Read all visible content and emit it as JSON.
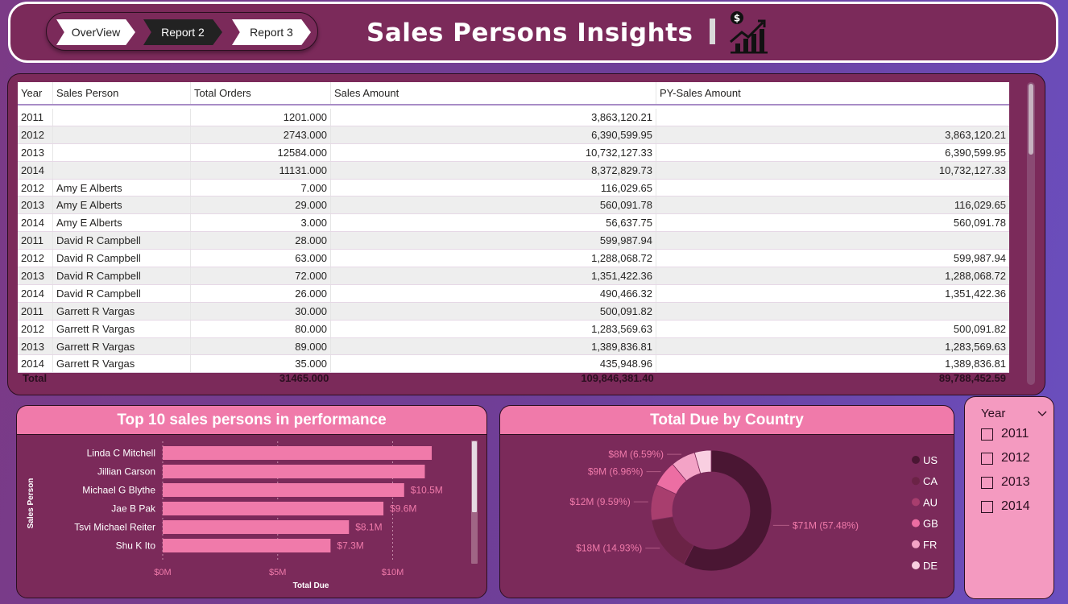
{
  "nav": {
    "buttons": [
      "OverView",
      "Report 2",
      "Report 3"
    ]
  },
  "header": {
    "title": "Sales Persons Insights"
  },
  "table": {
    "columns": [
      "Year",
      "Sales Person",
      "Total Orders",
      "Sales Amount",
      "PY-Sales Amount"
    ],
    "rows": [
      [
        "2011",
        "",
        "1201.000",
        "3,863,120.21",
        ""
      ],
      [
        "2012",
        "",
        "2743.000",
        "6,390,599.95",
        "3,863,120.21"
      ],
      [
        "2013",
        "",
        "12584.000",
        "10,732,127.33",
        "6,390,599.95"
      ],
      [
        "2014",
        "",
        "11131.000",
        "8,372,829.73",
        "10,732,127.33"
      ],
      [
        "2012",
        "Amy E Alberts",
        "7.000",
        "116,029.65",
        ""
      ],
      [
        "2013",
        "Amy E Alberts",
        "29.000",
        "560,091.78",
        "116,029.65"
      ],
      [
        "2014",
        "Amy E Alberts",
        "3.000",
        "56,637.75",
        "560,091.78"
      ],
      [
        "2011",
        "David R Campbell",
        "28.000",
        "599,987.94",
        ""
      ],
      [
        "2012",
        "David R Campbell",
        "63.000",
        "1,288,068.72",
        "599,987.94"
      ],
      [
        "2013",
        "David R Campbell",
        "72.000",
        "1,351,422.36",
        "1,288,068.72"
      ],
      [
        "2014",
        "David R Campbell",
        "26.000",
        "490,466.32",
        "1,351,422.36"
      ],
      [
        "2011",
        "Garrett R Vargas",
        "30.000",
        "500,091.82",
        ""
      ],
      [
        "2012",
        "Garrett R Vargas",
        "80.000",
        "1,283,569.63",
        "500,091.82"
      ],
      [
        "2013",
        "Garrett R Vargas",
        "89.000",
        "1,389,836.81",
        "1,283,569.63"
      ],
      [
        "2014",
        "Garrett R Vargas",
        "35.000",
        "435,948.96",
        "1,389,836.81"
      ]
    ],
    "total": {
      "label": "Total",
      "orders": "31465.000",
      "sales": "109,846,381.40",
      "py_sales": "89,788,452.59"
    }
  },
  "slicer": {
    "title": "Year",
    "options": [
      "2011",
      "2012",
      "2013",
      "2014"
    ]
  },
  "colors": {
    "panel": "#7b2a5a",
    "accent": "#f07aaa",
    "slicer": "#f49ac0"
  },
  "chart_data": [
    {
      "type": "bar",
      "title": "Top 10 sales persons in performance",
      "xlabel": "Total Due",
      "ylabel": "Sales Person",
      "orientation": "horizontal",
      "categories": [
        "Linda C Mitchell",
        "Jillian Carson",
        "Michael G Blythe",
        "Jae B Pak",
        "Tsvi Michael Reiter",
        "Shu K Ito"
      ],
      "values": [
        11.7,
        11.4,
        10.5,
        9.6,
        8.1,
        7.3
      ],
      "data_labels": [
        "",
        "",
        "$10.5M",
        "$9.6M",
        "$8.1M",
        "$7.3M"
      ],
      "xticks": [
        "$0M",
        "$5M",
        "$10M"
      ],
      "xtick_values": [
        0,
        5,
        10
      ],
      "xlim": [
        0,
        13.1
      ],
      "grid": true,
      "bar_color": "#f07aaa"
    },
    {
      "type": "pie",
      "title": "Total Due by Country",
      "donut": true,
      "labels": [
        "US",
        "CA",
        "AU",
        "GB",
        "FR",
        "DE"
      ],
      "values": [
        57.48,
        14.93,
        9.59,
        6.96,
        6.59,
        4.45
      ],
      "data_labels": [
        "$71M (57.48%)",
        "$18M (14.93%)",
        "$12M (9.59%)",
        "$9M (6.96%)",
        "$8M (6.59%)",
        ""
      ],
      "colors": [
        "#4a1633",
        "#6b2346",
        "#a83e6e",
        "#ec6ea3",
        "#f3a3c6",
        "#f9cfe1"
      ],
      "legend": "right"
    }
  ]
}
